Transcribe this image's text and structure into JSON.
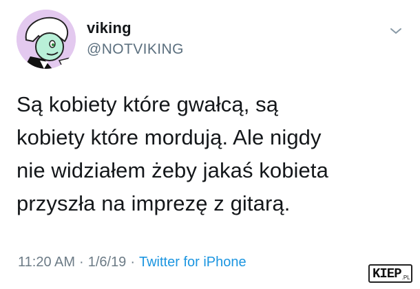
{
  "tweet": {
    "author": {
      "display_name": "viking",
      "handle": "@NOTVIKING",
      "avatar": "avatar-cartoon-character"
    },
    "menu_icon": "chevron-down-icon",
    "text": "Są kobiety które gwałcą, są\nkobiety które mordują. Ale nigdy\nnie widziałem żeby jakaś kobieta\nprzyszła na imprezę z gitarą.",
    "meta": {
      "time": "11:20 AM",
      "separator": "·",
      "date": "1/6/19",
      "source": "Twitter for iPhone"
    }
  },
  "watermark": {
    "main": "KIEP",
    "suffix": ".PL"
  },
  "colors": {
    "text": "#14171a",
    "secondary": "#5b6f7e",
    "link": "#1b95e0",
    "avatar_bg": "#e3c9ef"
  }
}
